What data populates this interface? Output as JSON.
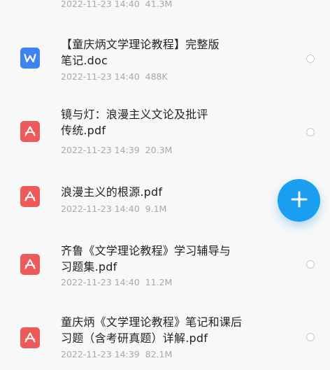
{
  "files": [
    {
      "name": "",
      "date": "2022-11-23 14:40",
      "size": "41.3M",
      "icon": "pdf-file-icon"
    },
    {
      "name": "【童庆炳文学理论教程】完整版\n笔记.doc",
      "date": "2022-11-23 14:40",
      "size": "488K",
      "icon": "word-file-icon"
    },
    {
      "name": "镜与灯：浪漫主义文论及批评\n传统.pdf",
      "date": "2022-11-23 14:39",
      "size": "20.3M",
      "icon": "pdf-file-icon"
    },
    {
      "name": "浪漫主义的根源.pdf",
      "date": "2022-11-23 14:40",
      "size": "9.1M",
      "icon": "pdf-file-icon"
    },
    {
      "name": "齐鲁《文学理论教程》学习辅导与\n习题集.pdf",
      "date": "2022-11-23 14:40",
      "size": "11.2M",
      "icon": "pdf-file-icon"
    },
    {
      "name": "童庆炳《文学理论教程》笔记和课后\n习题（含考研真题）详解.pdf",
      "date": "2022-11-23 14:39",
      "size": "82.1M",
      "icon": "pdf-file-icon"
    }
  ],
  "fab": {
    "icon": "plus-icon",
    "color": "#1a9ef0"
  },
  "colors": {
    "word_icon": "#3d84f2",
    "pdf_icon": "#ee5a5a",
    "meta_text": "#a8a8a8",
    "title_text": "#222222"
  }
}
